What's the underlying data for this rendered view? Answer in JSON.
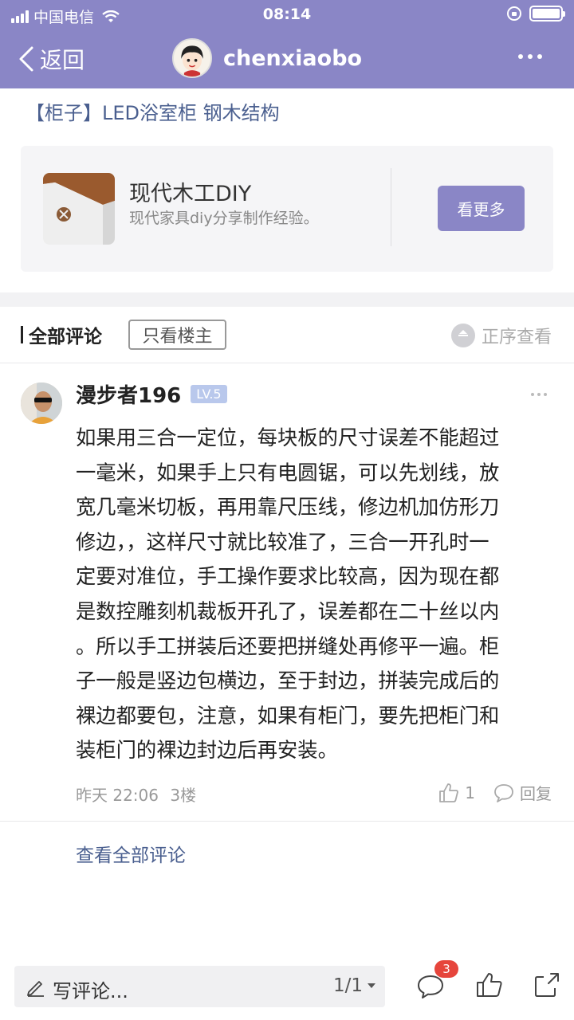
{
  "status_bar": {
    "carrier": "中国电信",
    "time": "08:14"
  },
  "nav": {
    "back_label": "返回",
    "title": "chenxiaobo"
  },
  "article": {
    "title": "【柜子】LED浴室柜 钢木结构"
  },
  "card": {
    "name": "现代木工DIY",
    "desc": "现代家具diy分享制作经验。",
    "button": "看更多"
  },
  "comments_header": {
    "title": "全部评论",
    "filter": "只看楼主",
    "sort": "正序查看"
  },
  "comment": {
    "user": "漫步者196",
    "level": "LV.5",
    "lines": [
      "如果用三合一定位，每块板的尺寸误差不能超过",
      "一毫米，如果手上只有电圆锯，可以先划线，放",
      "宽几毫米切板，再用靠尺压线，修边机加仿形刀",
      "修边，，这样尺寸就比较准了，三合一开孔时一",
      "定要对准位，手工操作要求比较高，因为现在都",
      "是数控雕刻机裁板开孔了，误差都在二十丝以内",
      "。所以手工拼装后还要把拼缝处再修平一遍。柜",
      "子一般是竖边包横边，至于封边，拼装完成后的",
      "裸边都要包，注意，如果有柜门，要先把柜门和",
      "装柜门的裸边封边后再安装。"
    ],
    "time": "昨天 22:06",
    "floor": "3楼",
    "likes": "1",
    "reply_label": "回复"
  },
  "view_all": "查看全部评论",
  "bottom_bar": {
    "write_label": "写评论...",
    "page_indicator": "1/1",
    "comment_badge": "3"
  },
  "colors": {
    "header": "#8a86c6",
    "link": "#4a5f8f",
    "badge": "#e6453c",
    "level": "#b9c8ec"
  }
}
